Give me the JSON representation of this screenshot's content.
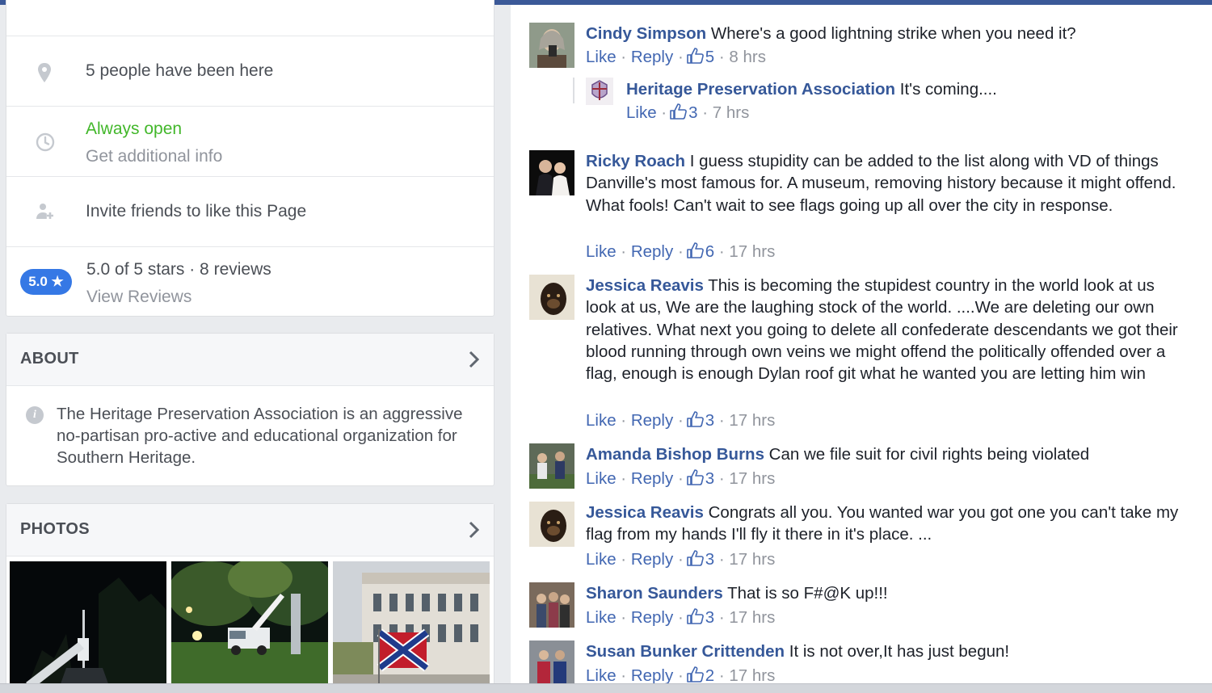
{
  "page": {
    "info": {
      "checkins": "5 people have been here",
      "hours_status": "Always open",
      "hours_more": "Get additional info",
      "invite": "Invite friends to like this Page",
      "rating_badge": "5.0 ★",
      "rating_text": "5.0 of 5 stars · 8 reviews",
      "view_reviews": "View Reviews"
    },
    "about": {
      "heading": "ABOUT",
      "body": "The Heritage Preservation Association is an aggressive no-partisan pro-active and educational organization for Southern Heritage."
    },
    "photos": {
      "heading": "PHOTOS"
    }
  },
  "comments": [
    {
      "author": "Cindy Simpson",
      "text": "Where's a good lightning strike when you need it?",
      "like": "Like",
      "reply": "Reply",
      "likes": "5",
      "time": "8 hrs"
    },
    {
      "author": "Heritage Preservation Association",
      "text": "It's coming....",
      "like": "Like",
      "likes": "3",
      "time": "7 hrs"
    },
    {
      "author": "Ricky Roach",
      "text": "I guess stupidity can be added to the list along with VD of things Danville's most famous for. A museum, removing history because it might offend. What fools! Can't wait to see flags going up all over the city in response.",
      "like": "Like",
      "reply": "Reply",
      "likes": "6",
      "time": "17 hrs"
    },
    {
      "author": "Jessica Reavis",
      "text": "This is becoming the stupidest country in the world look at us look at us, We are the laughing stock of the world. ....We are deleting our own relatives. What next you going to delete all confederate descendants we got their blood running through own veins we might offend the politically offended over a flag, enough is enough Dylan roof git what he wanted you are letting him win",
      "like": "Like",
      "reply": "Reply",
      "likes": "3",
      "time": "17 hrs"
    },
    {
      "author": "Amanda Bishop Burns",
      "text": "Can we file suit for civil rights being violated",
      "like": "Like",
      "reply": "Reply",
      "likes": "3",
      "time": "17 hrs"
    },
    {
      "author": "Jessica Reavis",
      "text": "Congrats all you. You wanted war you got one you can't take my flag from my hands I'll fly it there in it's place. ...",
      "like": "Like",
      "reply": "Reply",
      "likes": "3",
      "time": "17 hrs"
    },
    {
      "author": "Sharon Saunders",
      "text": "That is so F#@K up!!!",
      "like": "Like",
      "reply": "Reply",
      "likes": "3",
      "time": "17 hrs"
    },
    {
      "author": "Susan Bunker Crittenden",
      "text": "It is not over,It has just begun!",
      "like": "Like",
      "reply": "Reply",
      "likes": "2",
      "time": "17 hrs"
    }
  ],
  "icons": {
    "checkins": "map-pin-icon",
    "hours": "clock-icon",
    "invite": "add-person-icon",
    "about_info": "info-icon",
    "chevron": "chevron-right-icon",
    "like": "thumbs-up-icon"
  },
  "colors": {
    "brand_blue": "#3b5998",
    "link_blue": "#365899",
    "rating_blue": "#3578e5",
    "open_green": "#42b72a",
    "meta_grey": "#90949c"
  }
}
